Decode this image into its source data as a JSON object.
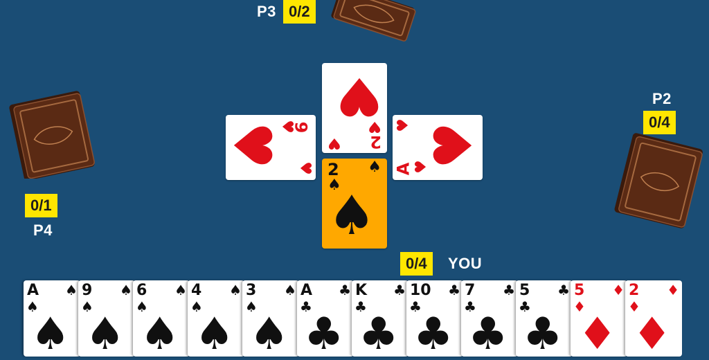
{
  "players": {
    "p3": {
      "name": "P3",
      "score": "0/2"
    },
    "p2": {
      "name": "P2",
      "score": "0/4"
    },
    "p4": {
      "name": "P4",
      "score": "0/1"
    },
    "you": {
      "name": "YOU",
      "score": "0/4"
    }
  },
  "trick": {
    "top": {
      "rank": "2",
      "suit": "♥",
      "color": "#e0101a"
    },
    "left": {
      "rank": "9",
      "suit": "♥",
      "color": "#e0101a"
    },
    "right": {
      "rank": "A",
      "suit": "♥",
      "color": "#e0101a"
    },
    "bottom": {
      "rank": "2",
      "suit": "♠",
      "color": "#101010",
      "highlight": "#ffa800"
    }
  },
  "hand": [
    {
      "rank": "A",
      "suit": "♠",
      "color": "black"
    },
    {
      "rank": "9",
      "suit": "♠",
      "color": "black"
    },
    {
      "rank": "6",
      "suit": "♠",
      "color": "black"
    },
    {
      "rank": "4",
      "suit": "♠",
      "color": "black"
    },
    {
      "rank": "3",
      "suit": "♠",
      "color": "black"
    },
    {
      "rank": "A",
      "suit": "♣",
      "color": "black"
    },
    {
      "rank": "K",
      "suit": "♣",
      "color": "black"
    },
    {
      "rank": "10",
      "suit": "♣",
      "color": "black"
    },
    {
      "rank": "7",
      "suit": "♣",
      "color": "black"
    },
    {
      "rank": "5",
      "suit": "♣",
      "color": "black"
    },
    {
      "rank": "5",
      "suit": "♦",
      "color": "red"
    },
    {
      "rank": "2",
      "suit": "♦",
      "color": "red"
    }
  ],
  "colors": {
    "table": "#1a4d75",
    "score_badge": "#ffe600",
    "card_back": "#5a2a14"
  }
}
